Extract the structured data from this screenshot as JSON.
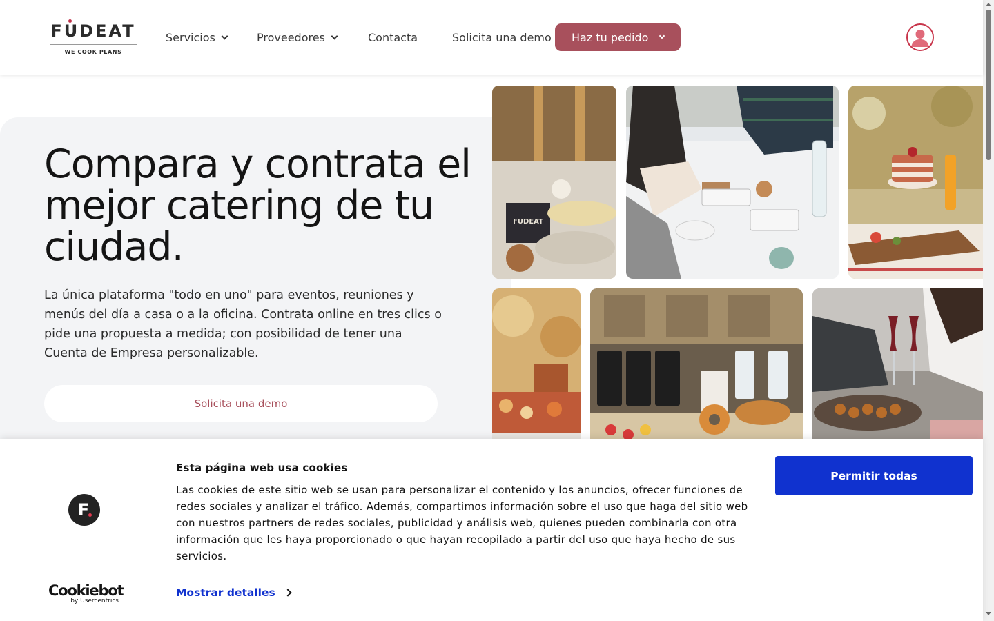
{
  "brand": {
    "logo_text": "FUDEAT",
    "tagline": "WE COOK PLANS",
    "accent_color": "#a8505c"
  },
  "nav": {
    "items": [
      {
        "label": "Servicios",
        "has_dropdown": true
      },
      {
        "label": "Proveedores",
        "has_dropdown": true
      },
      {
        "label": "Contacta",
        "has_dropdown": false
      },
      {
        "label": "Solicita una demo",
        "has_dropdown": false
      }
    ],
    "order_button": "Haz tu pedido",
    "user_icon": "user-circle-icon"
  },
  "hero": {
    "title": "Compara y contrata el mejor catering de tu ciudad.",
    "description": "La única plataforma \"todo en uno\" para eventos, reuniones y menús del día a casa o a la oficina. Contrata online en tres clics o pide una propuesta a medida; con posibilidad de tener una Cuenta de Empresa personalizable.",
    "cta_label": "Solicita una demo"
  },
  "cookie_banner": {
    "title": "Esta página web usa cookies",
    "body": "Las cookies de este sitio web se usan para personalizar el contenido y los anuncios, ofrecer funciones de redes sociales y analizar el tráfico. Además, compartimos información sobre el uso que haga del sitio web con nuestros partners de redes sociales, publicidad y análisis web, quienes pueden combinarla con otra información que les haya proporcionado o que hayan recopilado a partir del uso que haya hecho de sus servicios.",
    "details_link": "Mostrar detalles",
    "allow_button": "Permitir todas",
    "logo_letter": "F",
    "provider_name": "Cookiebot",
    "provider_sub": "by Usercentrics",
    "button_color": "#1032cf"
  }
}
